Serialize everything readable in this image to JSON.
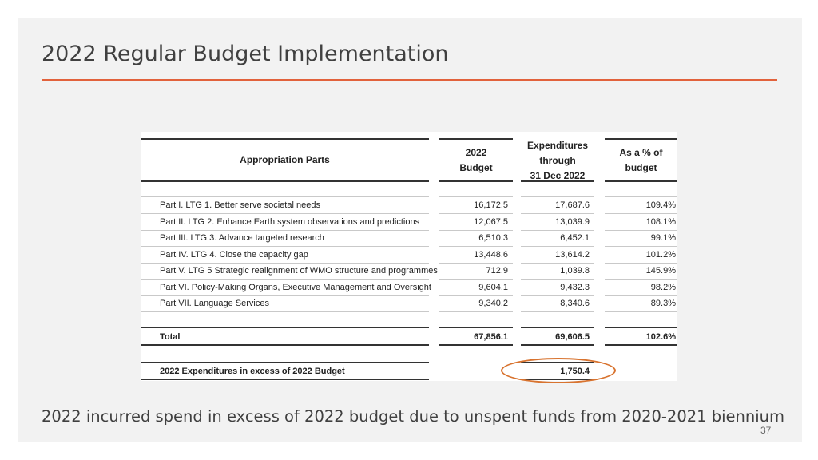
{
  "title": "2022 Regular Budget Implementation",
  "table": {
    "headers": {
      "parts": "Appropriation Parts",
      "budget": [
        "2022",
        "Budget"
      ],
      "expenditures": [
        "Expenditures",
        "through",
        "31 Dec 2022"
      ],
      "percent": [
        "As a % of",
        "budget"
      ]
    },
    "rows": [
      {
        "label": "Part I. LTG 1. Better serve societal needs",
        "budget": "16,172.5",
        "expenditures": "17,687.6",
        "percent": "109.4%"
      },
      {
        "label": "Part II. LTG 2. Enhance Earth system observations and predictions",
        "budget": "12,067.5",
        "expenditures": "13,039.9",
        "percent": "108.1%"
      },
      {
        "label": "Part III. LTG 3. Advance targeted research",
        "budget": "6,510.3",
        "expenditures": "6,452.1",
        "percent": "99.1%"
      },
      {
        "label": "Part IV. LTG 4. Close the capacity gap",
        "budget": "13,448.6",
        "expenditures": "13,614.2",
        "percent": "101.2%"
      },
      {
        "label": "Part V. LTG 5 Strategic realignment of WMO structure and programmes",
        "budget": "712.9",
        "expenditures": "1,039.8",
        "percent": "145.9%"
      },
      {
        "label": "Part VI. Policy-Making Organs, Executive Management and Oversight",
        "budget": "9,604.1",
        "expenditures": "9,432.3",
        "percent": "98.2%"
      },
      {
        "label": "Part VII. Language Services",
        "budget": "9,340.2",
        "expenditures": "8,340.6",
        "percent": "89.3%"
      }
    ],
    "total": {
      "label": "Total",
      "budget": "67,856.1",
      "expenditures": "69,606.5",
      "percent": "102.6%"
    },
    "excess": {
      "label": "2022 Expenditures in excess of 2022 Budget",
      "expenditures": "1,750.4"
    }
  },
  "highlight_color": "#d8732f",
  "accent_color": "#e2623c",
  "footnote": "2022 incurred spend in excess of 2022 budget due to unspent funds from 2020-2021 biennium",
  "page_number": "37"
}
